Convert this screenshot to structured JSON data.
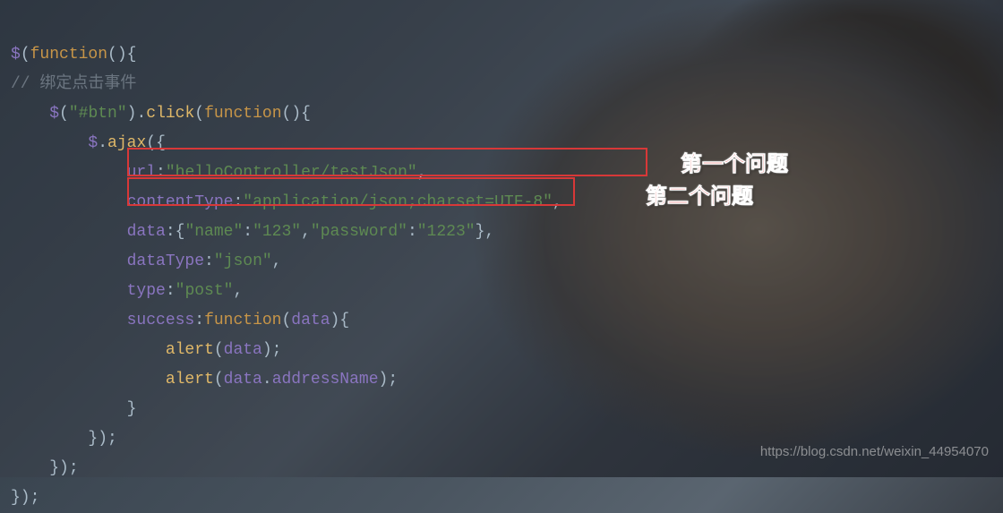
{
  "code": {
    "l1": {
      "a": "$",
      "b": "(",
      "c": "function",
      "d": "(){"
    },
    "l2": {
      "comment": "// 绑定点击事件"
    },
    "l3": {
      "indent": "    ",
      "a": "$",
      "b": "(",
      "c": "\"#btn\"",
      "d": ").",
      "e": "click",
      "f": "(",
      "g": "function",
      "h": "(){"
    },
    "l4": {
      "indent": "        ",
      "a": "$",
      "b": ".",
      "c": "ajax",
      "d": "({"
    },
    "l5": {
      "indent": "            ",
      "a": "url",
      "b": ":",
      "c": "\"helloController/testJson\"",
      "d": ","
    },
    "l6": {
      "indent": "            ",
      "a": "contentType",
      "b": ":",
      "c": "\"application/json;charset=UTF-8\"",
      "d": ","
    },
    "l7": {
      "indent": "            ",
      "a": "data",
      "b": ":{",
      "c": "\"name\"",
      "d": ":",
      "e": "\"123\"",
      "f": ",",
      "g": "\"password\"",
      "h": ":",
      "i": "\"1223\"",
      "j": "},"
    },
    "l8": {
      "indent": "            ",
      "a": "dataType",
      "b": ":",
      "c": "\"json\"",
      "d": ","
    },
    "l9": {
      "indent": "            ",
      "a": "type",
      "b": ":",
      "c": "\"post\"",
      "d": ","
    },
    "l10": {
      "indent": "            ",
      "a": "success",
      "b": ":",
      "c": "function",
      "d": "(",
      "e": "data",
      "f": "){"
    },
    "l11": {
      "indent": "                ",
      "a": "alert",
      "b": "(",
      "c": "data",
      "d": ");"
    },
    "l12": {
      "indent": "                ",
      "a": "alert",
      "b": "(",
      "c": "data",
      "d": ".",
      "e": "addressName",
      "f": ");"
    },
    "l13": {
      "indent": "            ",
      "a": "}"
    },
    "l14": {
      "indent": "        ",
      "a": "});"
    },
    "l15": {
      "indent": "    ",
      "a": "});"
    },
    "l16": {
      "a": "});"
    }
  },
  "annotations": {
    "first": "第一个问题",
    "second": "第二个问题"
  },
  "watermark": "https://blog.csdn.net/weixin_44954070"
}
